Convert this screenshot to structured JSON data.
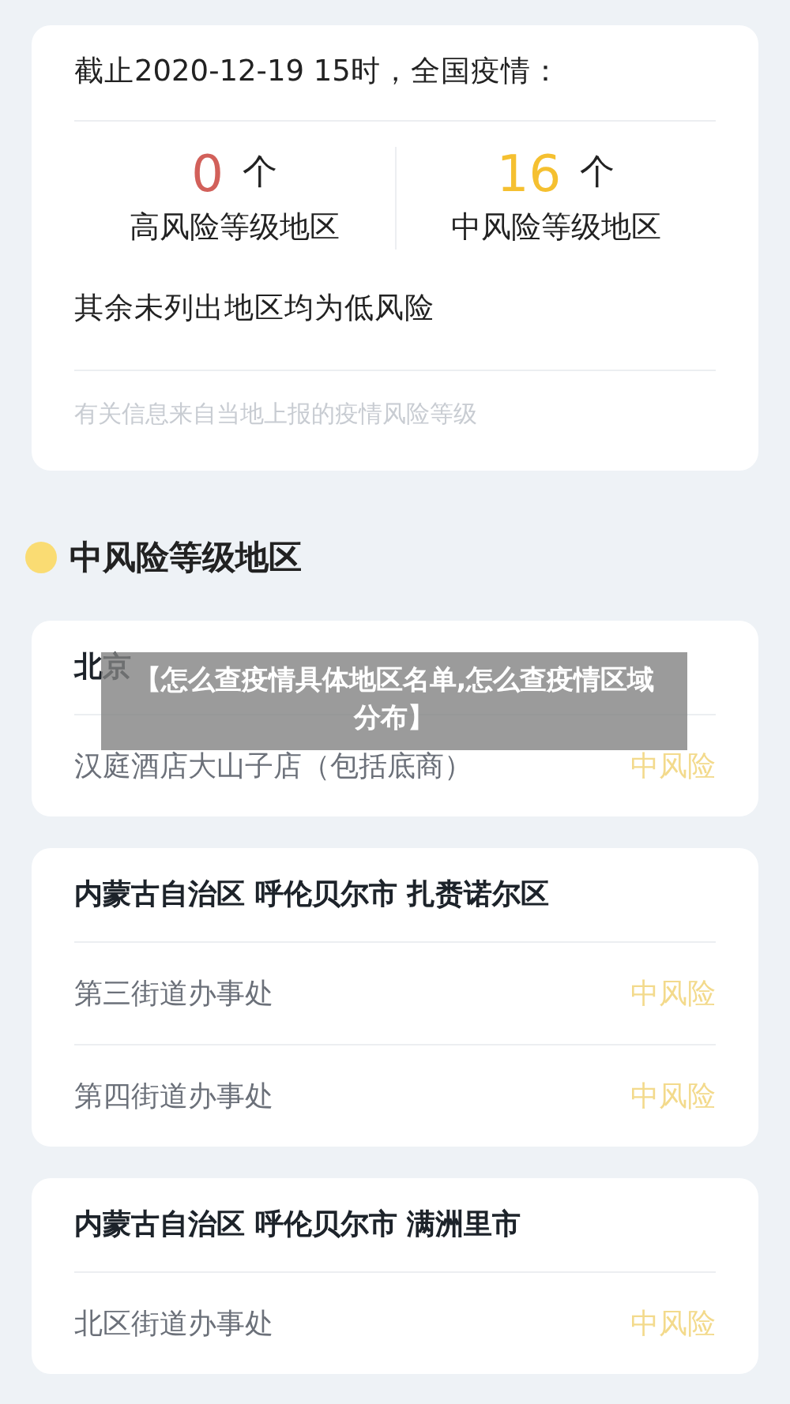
{
  "summary": {
    "title": "截止2020-12-19 15时，全国疫情：",
    "stats": [
      {
        "count": "0",
        "unit": "个",
        "label": "高风险等级地区",
        "color": "#d2605a"
      },
      {
        "count": "16",
        "unit": "个",
        "label": "中风险等级地区",
        "color": "#f5c030"
      }
    ],
    "note": "其余未列出地区均为低风险",
    "source": "有关信息来自当地上报的疫情风险等级"
  },
  "section": {
    "title": "中风险等级地区",
    "color": "#fadc73"
  },
  "groups": [
    {
      "region": "北京",
      "places": [
        {
          "name": "汉庭酒店大山子店（包括底商）",
          "risk": "中风险"
        }
      ]
    },
    {
      "region": "内蒙古自治区 呼伦贝尔市 扎赉诺尔区",
      "places": [
        {
          "name": "第三街道办事处",
          "risk": "中风险"
        },
        {
          "name": "第四街道办事处",
          "risk": "中风险"
        }
      ]
    },
    {
      "region": "内蒙古自治区 呼伦贝尔市 满洲里市",
      "places": [
        {
          "name": "北区街道办事处",
          "risk": "中风险"
        }
      ]
    }
  ],
  "overlay_banner": "【怎么查疫情具体地区名单,怎么查疫情区域分布】"
}
